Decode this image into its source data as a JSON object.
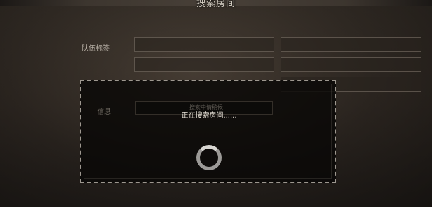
{
  "header": {
    "title": "搜索房间"
  },
  "form": {
    "team_tag_label": "队伍标签",
    "status_label": "信息",
    "hidden_field_text": "搜索中请稍候"
  },
  "dialog": {
    "message": "正在搜索房间......",
    "spinner_icon": "loading-spinner-icon"
  }
}
